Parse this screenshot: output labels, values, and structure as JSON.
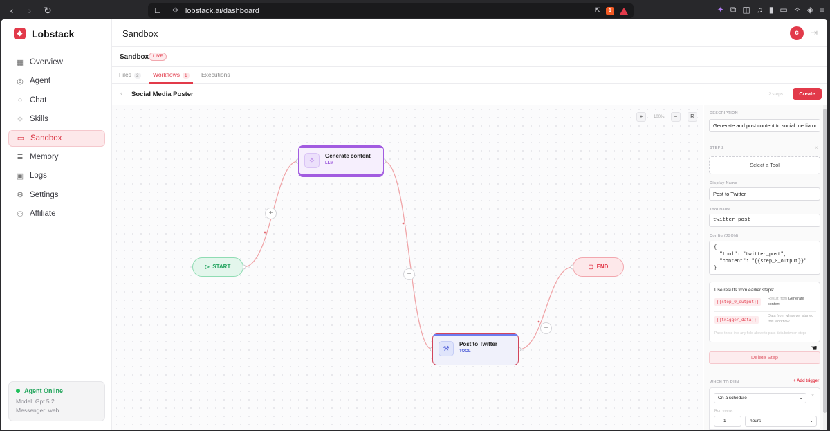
{
  "browser": {
    "url": "lobstack.ai/dashboard",
    "brave_badge": "1"
  },
  "app": {
    "brand": "Lobstack",
    "page_title": "Sandbox",
    "avatar_letter": "c",
    "accent": "#e23a4a"
  },
  "sidebar": {
    "items": [
      {
        "label": "Overview",
        "icon": "grid-icon"
      },
      {
        "label": "Agent",
        "icon": "bot-icon"
      },
      {
        "label": "Chat",
        "icon": "chat-icon"
      },
      {
        "label": "Skills",
        "icon": "sparkle-icon"
      },
      {
        "label": "Sandbox",
        "icon": "monitor-icon",
        "active": true
      },
      {
        "label": "Memory",
        "icon": "database-icon"
      },
      {
        "label": "Logs",
        "icon": "terminal-icon"
      },
      {
        "label": "Settings",
        "icon": "gear-icon"
      },
      {
        "label": "Affiliate",
        "icon": "users-icon"
      }
    ],
    "status": {
      "online": "Agent Online",
      "model": "Model: Gpt 5.2",
      "messenger": "Messenger: web"
    }
  },
  "sandbox": {
    "label": "Sandbox",
    "badge": "LIVE",
    "tabs": [
      {
        "label": "Files",
        "count": "2"
      },
      {
        "label": "Workflows",
        "count": "1",
        "active": true
      },
      {
        "label": "Executions",
        "count": ""
      }
    ]
  },
  "workflow": {
    "title": "Social Media Poster",
    "steps_count": "2 steps",
    "create_label": "Create",
    "zoom": "100%",
    "zoom_in": "+",
    "zoom_out": "−",
    "reset": "R",
    "nodes": {
      "start": "START",
      "end": "END",
      "llm": {
        "name": "Generate content",
        "type": "LLM"
      },
      "tool": {
        "name": "Post to Twitter",
        "type": "TOOL"
      }
    },
    "add_symbol": "+"
  },
  "panel": {
    "description_label": "DESCRIPTION",
    "description": "Generate and post content to social media or",
    "step_label": "STEP 2",
    "select_tool": "Select a Tool",
    "display_name_label": "Display Name",
    "display_name": "Post to Twitter",
    "tool_name_label": "Tool Name",
    "tool_name": "twitter_post",
    "config_label": "Config (JSON)",
    "config": "{\n  \"tool\": \"twitter_post\",\n  \"content\": \"{{step_0_output}}\"\n}",
    "refs_title": "Use results from earlier steps:",
    "refs": [
      {
        "tag": "{{step_0_output}}",
        "desc_prefix": "Result from",
        "desc_bold": "Generate content"
      },
      {
        "tag": "{{trigger_data}}",
        "desc_prefix": "Data from whatever started this workflow",
        "desc_bold": ""
      }
    ],
    "refs_hint": "Paste these into any field above to pass data between steps",
    "delete_label": "Delete Step",
    "when_label": "WHEN TO RUN",
    "add_trigger": "+ Add trigger",
    "trigger_type": "On a schedule",
    "run_every_label": "Run every:",
    "run_every_value": "1",
    "run_every_unit": "hours"
  }
}
